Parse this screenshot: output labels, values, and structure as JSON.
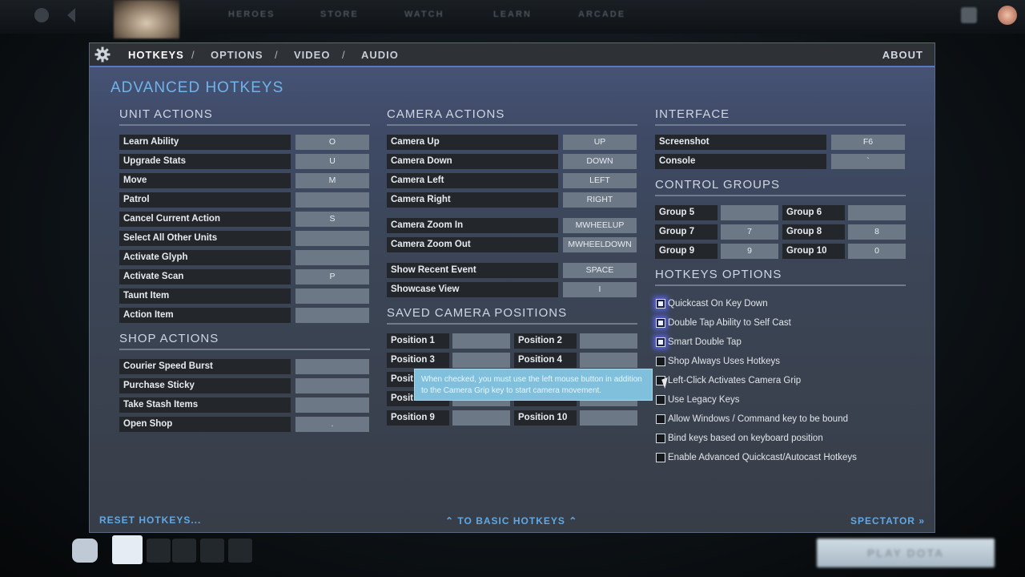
{
  "topnav": {
    "items": [
      "HEROES",
      "STORE",
      "WATCH",
      "LEARN",
      "ARCADE"
    ],
    "bottom_play_label": "PLAY DOTA"
  },
  "header": {
    "tabs": [
      {
        "label": "HOTKEYS",
        "active": true
      },
      {
        "label": "OPTIONS",
        "active": false
      },
      {
        "label": "VIDEO",
        "active": false
      },
      {
        "label": "AUDIO",
        "active": false
      }
    ],
    "separator": "/",
    "about": "ABOUT"
  },
  "page_title": "ADVANCED HOTKEYS",
  "unit_actions": {
    "title": "UNIT ACTIONS",
    "rows": [
      {
        "label": "Learn Ability",
        "key": "O"
      },
      {
        "label": "Upgrade Stats",
        "key": "U"
      },
      {
        "label": "Move",
        "key": "M"
      },
      {
        "label": "Patrol",
        "key": ""
      },
      {
        "label": "Cancel Current Action",
        "key": "S"
      },
      {
        "label": "Select All Other Units",
        "key": ""
      },
      {
        "label": "Activate Glyph",
        "key": ""
      },
      {
        "label": "Activate Scan",
        "key": "P"
      },
      {
        "label": "Taunt Item",
        "key": ""
      },
      {
        "label": "Action Item",
        "key": ""
      }
    ]
  },
  "shop_actions": {
    "title": "SHOP ACTIONS",
    "rows": [
      {
        "label": "Courier Speed Burst",
        "key": ""
      },
      {
        "label": "Purchase Sticky",
        "key": ""
      },
      {
        "label": "Take Stash Items",
        "key": ""
      },
      {
        "label": "Open Shop",
        "key": "."
      }
    ]
  },
  "camera_actions": {
    "title": "CAMERA ACTIONS",
    "rows": [
      {
        "label": "Camera Up",
        "key": "UP"
      },
      {
        "label": "Camera Down",
        "key": "DOWN"
      },
      {
        "label": "Camera Left",
        "key": "LEFT"
      },
      {
        "label": "Camera Right",
        "key": "RIGHT"
      },
      {
        "label": "Camera Zoom In",
        "key": "MWHEELUP"
      },
      {
        "label": "Camera Zoom Out",
        "key": "MWHEELDOWN"
      },
      {
        "label": "Show Recent Event",
        "key": "SPACE"
      },
      {
        "label": "Showcase View",
        "key": "I"
      }
    ]
  },
  "saved_camera": {
    "title": "SAVED CAMERA POSITIONS",
    "rows": [
      {
        "label": "Position 1",
        "key": ""
      },
      {
        "label": "Position 2",
        "key": ""
      },
      {
        "label": "Position 3",
        "key": ""
      },
      {
        "label": "Position 4",
        "key": ""
      },
      {
        "label": "Positi",
        "key": ""
      },
      {
        "label": "",
        "key": ""
      },
      {
        "label": "Positi",
        "key": ""
      },
      {
        "label": "",
        "key": ""
      },
      {
        "label": "Position 9",
        "key": ""
      },
      {
        "label": "Position 10",
        "key": ""
      }
    ]
  },
  "interface": {
    "title": "INTERFACE",
    "rows": [
      {
        "label": "Screenshot",
        "key": "F6"
      },
      {
        "label": "Console",
        "key": "`"
      }
    ]
  },
  "control_groups": {
    "title": "CONTROL GROUPS",
    "rows": [
      {
        "label": "Group 5",
        "key": ""
      },
      {
        "label": "Group 6",
        "key": ""
      },
      {
        "label": "Group 7",
        "key": "7"
      },
      {
        "label": "Group 8",
        "key": "8"
      },
      {
        "label": "Group 9",
        "key": "9"
      },
      {
        "label": "Group 10",
        "key": "0"
      }
    ]
  },
  "hotkey_options": {
    "title": "HOTKEYS OPTIONS",
    "items": [
      {
        "label": "Quickcast On Key Down",
        "checked": true
      },
      {
        "label": "Double Tap Ability to Self Cast",
        "checked": true
      },
      {
        "label": "Smart Double Tap",
        "checked": true
      },
      {
        "label": "Shop Always Uses Hotkeys",
        "checked": false
      },
      {
        "label": "Left-Click Activates Camera Grip",
        "checked": false
      },
      {
        "label": "Use Legacy Keys",
        "checked": false
      },
      {
        "label": "Allow Windows / Command key to be bound",
        "checked": false
      },
      {
        "label": "Bind keys based on keyboard position",
        "checked": false
      },
      {
        "label": "Enable Advanced Quickcast/Autocast Hotkeys",
        "checked": false
      }
    ]
  },
  "tooltip": "When checked, you must use the left mouse button in addition to the Camera Grip key to start camera movement.",
  "footer": {
    "reset": "RESET HOTKEYS...",
    "basic": "TO BASIC HOTKEYS",
    "spectator": "SPECTATOR"
  },
  "colors": {
    "accent_blue": "#6fb3ec",
    "header_underline": "#5b76c8",
    "key_cell": "#6c7886",
    "label_cell": "#23262a"
  }
}
